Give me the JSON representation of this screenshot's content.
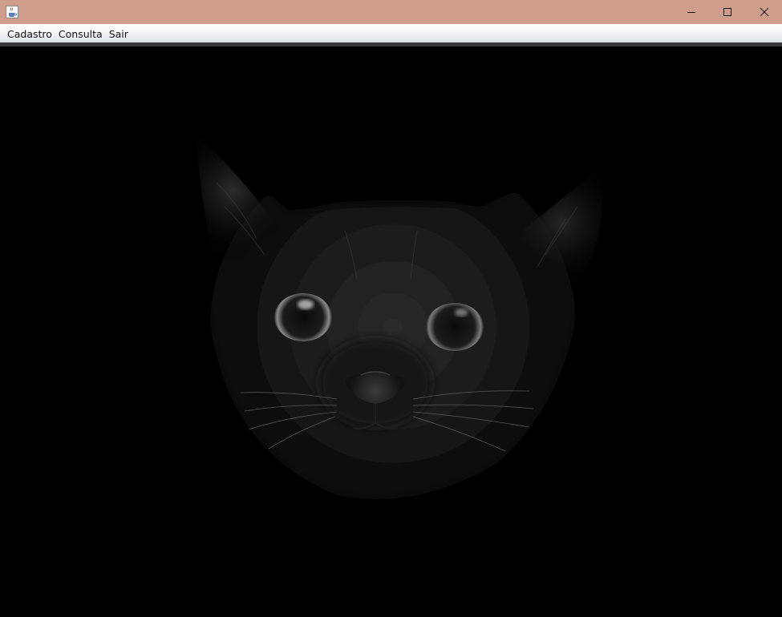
{
  "window": {
    "titlebar_color": "#cf9d8b",
    "icons": {
      "app": "java-cup-icon",
      "minimize": "minimize-icon",
      "maximize": "maximize-icon",
      "close": "close-icon"
    }
  },
  "menubar": {
    "items": [
      {
        "label": "Cadastro"
      },
      {
        "label": "Consulta"
      },
      {
        "label": "Sair"
      }
    ]
  },
  "content": {
    "image": "black-cat-face-image",
    "background": "#000000"
  }
}
